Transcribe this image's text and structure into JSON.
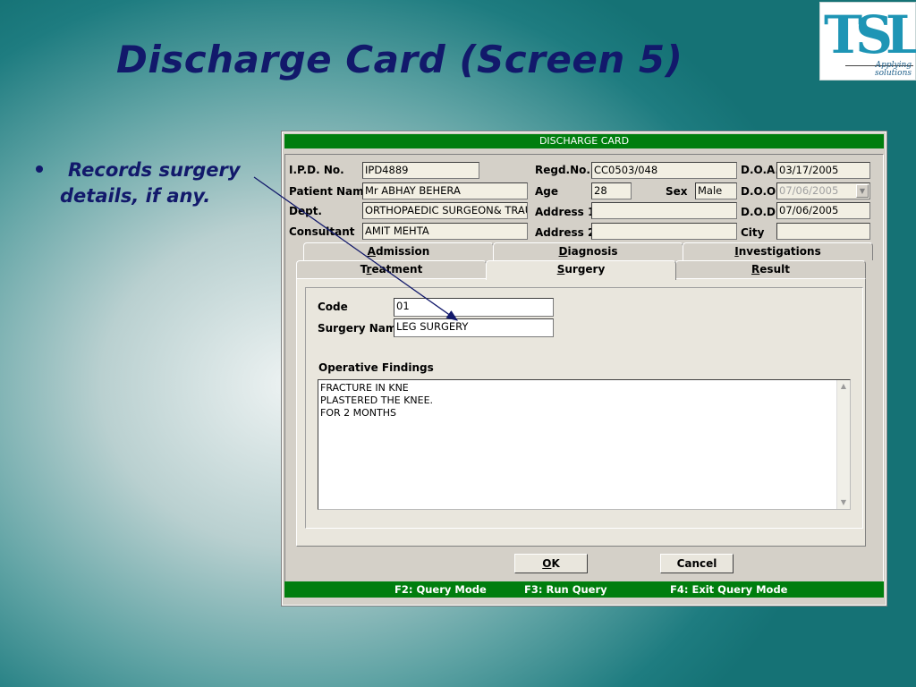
{
  "slide": {
    "title": "Discharge Card (Screen 5)",
    "bullet_line1": "Records surgery",
    "bullet_line2": "details, if any.",
    "logo_letters": "TSL",
    "logo_tagline1": "Applying",
    "logo_tagline2": "solutions"
  },
  "window": {
    "title": "DISCHARGE CARD"
  },
  "header": {
    "ipd_label": "I.P.D. No.",
    "ipd_value": "IPD4889",
    "regd_label": "Regd.No.",
    "regd_value": "CC0503/048",
    "doa_label": "D.O.A.",
    "doa_value": "03/17/2005",
    "patient_label": "Patient Name",
    "patient_value": "Mr ABHAY BEHERA",
    "age_label": "Age",
    "age_value": "28",
    "sex_label": "Sex",
    "sex_value": "Male",
    "doo_label": "D.O.O.",
    "doo_value": "07/06/2005",
    "dept_label": "Dept.",
    "dept_value": "ORTHOPAEDIC SURGEON& TRAUMA",
    "address1_label": "Address 1",
    "address1_value": "",
    "dod_label": "D.O.D.",
    "dod_value": "07/06/2005",
    "consultant_label": "Consultant",
    "consultant_value": "AMIT MEHTA",
    "address2_label": "Address 2",
    "address2_value": "",
    "city_label": "City",
    "city_value": ""
  },
  "tabs": {
    "row1": [
      {
        "key": "A",
        "rest": "dmission"
      },
      {
        "key": "D",
        "rest": "iagnosis"
      },
      {
        "key": "I",
        "rest": "nvestigations"
      }
    ],
    "row2": [
      {
        "pre": "T",
        "key": "r",
        "rest": "eatment"
      },
      {
        "pre": "",
        "key": "S",
        "rest": "urgery"
      },
      {
        "pre": "",
        "key": "R",
        "rest": "esult"
      }
    ]
  },
  "surgery": {
    "code_label": "Code",
    "code_value": "01",
    "name_label": "Surgery Name",
    "name_value": "LEG SURGERY",
    "findings_label": "Operative Findings",
    "findings_lines": [
      "FRACTURE IN KNE",
      "PLASTERED THE KNEE.",
      "FOR 2 MONTHS"
    ]
  },
  "buttons": {
    "ok_key": "O",
    "ok_rest": "K",
    "cancel_label": "Cancel"
  },
  "status": {
    "f2": "F2: Query Mode",
    "f3": "F3: Run Query",
    "f4": "F4: Exit Query Mode"
  },
  "colors": {
    "title_text": "#12196b",
    "window_bar": "#007e0e",
    "dialog_bg": "#d4d0c8"
  }
}
